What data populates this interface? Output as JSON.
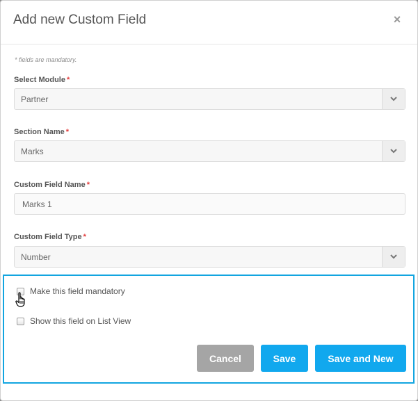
{
  "modal": {
    "title": "Add new Custom Field",
    "close_glyph": "×",
    "mandatory_note": "* fields are mandatory."
  },
  "fields": {
    "module": {
      "label": "Select Module",
      "value": "Partner",
      "required_mark": "*"
    },
    "section": {
      "label": "Section Name",
      "value": "Marks",
      "required_mark": "*"
    },
    "field_name": {
      "label": "Custom Field Name",
      "value": "Marks 1",
      "required_mark": "*"
    },
    "field_type": {
      "label": "Custom Field Type",
      "value": "Number",
      "required_mark": "*"
    }
  },
  "options": {
    "mandatory": {
      "label": "Make this field mandatory",
      "checked": false
    },
    "list_view": {
      "label": "Show this field on List View",
      "checked": false
    }
  },
  "buttons": {
    "cancel": "Cancel",
    "save": "Save",
    "save_new": "Save and New"
  },
  "colors": {
    "accent": "#11a8ee",
    "highlight": "#12a5e0",
    "cancel": "#a5a5a5",
    "required": "#e23b3b"
  },
  "icons": {
    "close": "close-icon",
    "dropdown": "chevron-down-icon",
    "cursor": "hand-pointer-icon"
  }
}
